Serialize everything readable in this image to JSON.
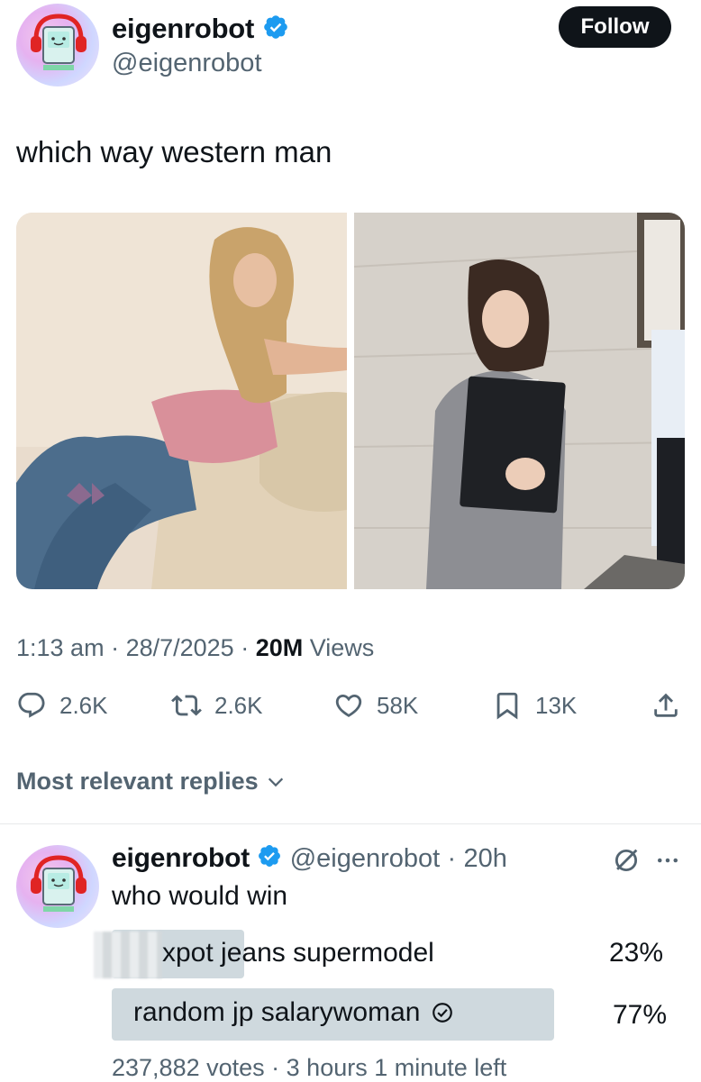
{
  "tweet": {
    "author_name": "eigenrobot",
    "author_handle": "@eigenrobot",
    "follow_label": "Follow",
    "text": "which way western man",
    "time": "1:13 am",
    "date": "28/7/2025",
    "views_count": "20M",
    "views_label": "Views",
    "actions": {
      "replies": "2.6K",
      "reposts": "2.6K",
      "likes": "58K",
      "bookmarks": "13K"
    }
  },
  "replies_header": "Most relevant replies",
  "reply": {
    "author_name": "eigenrobot",
    "author_handle": "@eigenrobot",
    "age": "20h",
    "text": "who would win",
    "poll": {
      "options": [
        {
          "label": "xpot jeans supermodel",
          "percent": "23%",
          "fraction": 0.23,
          "selected": false
        },
        {
          "label": "random jp salarywoman",
          "percent": "77%",
          "fraction": 0.77,
          "selected": true
        }
      ],
      "votes": "237,882 votes",
      "time_left": "3 hours 1 minute left"
    }
  },
  "colors": {
    "text": "#0f1419",
    "secondary": "#536471",
    "verified": "#1d9bf0",
    "poll_bar": "#cfd9de"
  }
}
